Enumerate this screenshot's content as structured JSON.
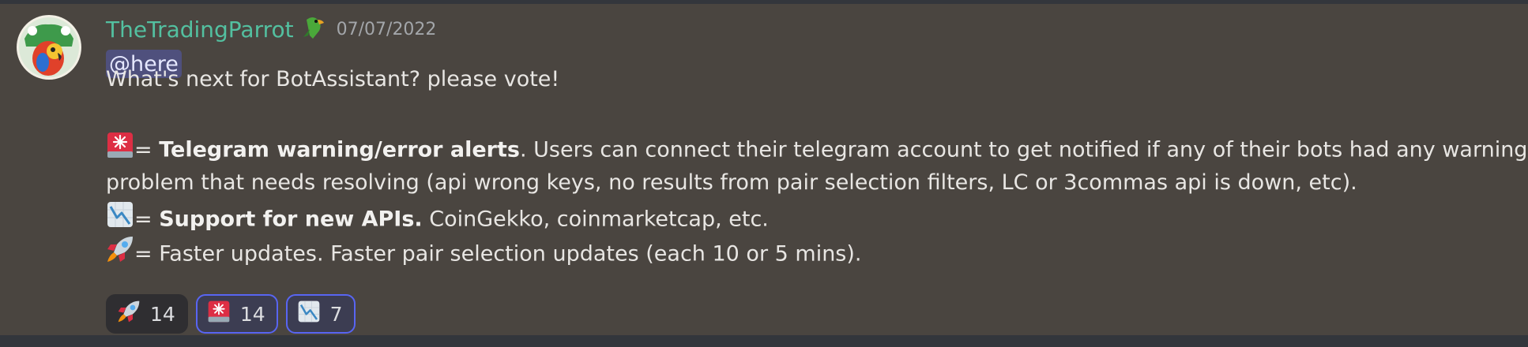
{
  "message": {
    "author": "TheTradingParrot",
    "timestamp": "07/07/2022",
    "mention": "@here",
    "intro": "What's next for BotAssistant? please vote!",
    "items": [
      {
        "icon": "rotating-light-icon",
        "prefix": "= ",
        "bold": "Telegram warning/error alerts",
        "text": ". Users can connect their telegram account to get notified if any of their bots had any warning or",
        "continuation": "problem that needs resolving (api wrong keys, no results from pair selection filters, LC or 3commas api is down, etc)."
      },
      {
        "icon": "chart-decreasing-icon",
        "prefix": "= ",
        "bold": "Support for new APIs.",
        "text": " CoinGekko, coinmarketcap, etc."
      },
      {
        "icon": "rocket-icon",
        "prefix": "= ",
        "text": "Faster updates. Faster pair selection updates (each 10 or 5 mins)."
      }
    ]
  },
  "reactions": [
    {
      "icon": "rocket-icon",
      "count": "14",
      "active": false
    },
    {
      "icon": "rotating-light-icon",
      "count": "14",
      "active": true
    },
    {
      "icon": "chart-decreasing-icon",
      "count": "7",
      "active": true
    }
  ],
  "colors": {
    "username": "#53c0a0",
    "background": "#4a4540",
    "reaction_active_border": "#5865f2"
  }
}
